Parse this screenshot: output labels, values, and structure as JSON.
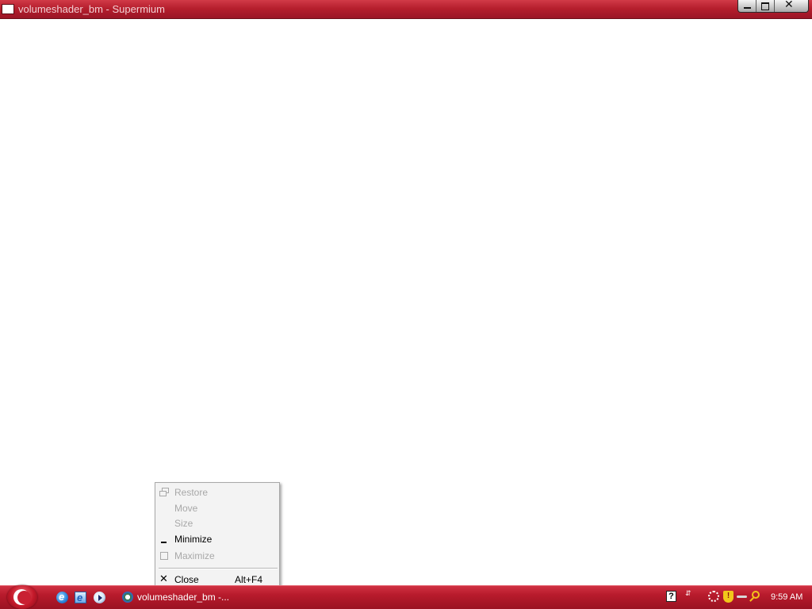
{
  "window": {
    "title": "volumeshader_bm - Supermium"
  },
  "context_menu": {
    "items": [
      {
        "label": "Restore",
        "enabled": false,
        "icon": "restore-icon"
      },
      {
        "label": "Move",
        "enabled": false
      },
      {
        "label": "Size",
        "enabled": false
      },
      {
        "label": "Minimize",
        "enabled": true,
        "icon": "minimize-icon"
      },
      {
        "label": "Maximize",
        "enabled": false,
        "icon": "maximize-icon"
      },
      {
        "label": "Close",
        "enabled": true,
        "icon": "close-icon",
        "shortcut": "Alt+F4"
      }
    ]
  },
  "taskbar": {
    "quick_launch": [
      "internet-explorer-icon",
      "internet-explorer-icon",
      "media-player-icon"
    ],
    "active_task": {
      "label": "volumeshader_bm -...",
      "icon": "supermium-browser-icon"
    },
    "tray_icons": [
      "help-icon",
      "network-icon",
      "gear-icon",
      "security-shield-icon",
      "power-plug-icon",
      "search-icon"
    ],
    "clock": "9:59 AM"
  },
  "colors": {
    "accent": "#b81b2c",
    "menu_background": "#f3f3f3",
    "disabled_text": "#a8a8a8"
  }
}
